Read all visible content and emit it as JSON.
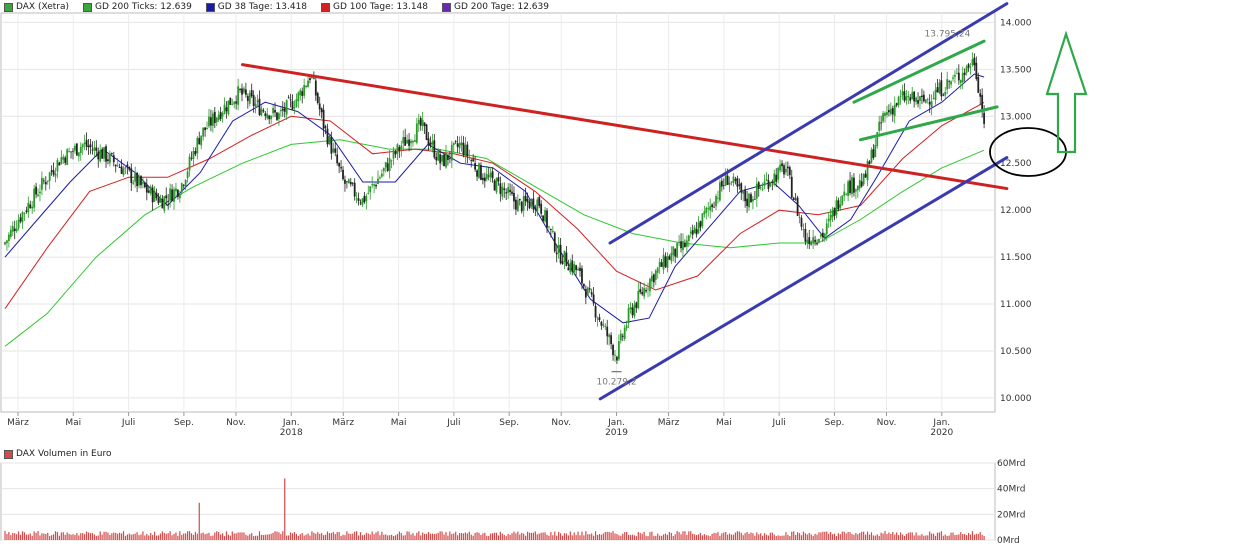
{
  "legend": [
    {
      "label": "DAX (Xetra)",
      "color": "#3ea43e"
    },
    {
      "label": "GD 200 Ticks: 12.639",
      "color": "#3ea43e"
    },
    {
      "label": "GD 38 Tage: 13.418",
      "color": "#1a1aa8"
    },
    {
      "label": "GD 100 Tage: 13.148",
      "color": "#d42020"
    },
    {
      "label": "GD 200 Tage: 12.639",
      "color": "#6a2ab0"
    }
  ],
  "volume_title": "DAX Volumen in Euro",
  "volume_color": "#d44a4a",
  "annotations": {
    "high": "13.795,24",
    "low": "10.279,2"
  },
  "chart_data": [
    {
      "type": "line",
      "series_label": "DAX (Xetra)",
      "y_ticks": [
        "14.000",
        "13.500",
        "13.000",
        "12.500",
        "12.000",
        "11.500",
        "11.000",
        "10.500",
        "10.000"
      ],
      "y_tick_values": [
        14000,
        13500,
        13000,
        12500,
        12000,
        11500,
        11000,
        10500,
        10000
      ],
      "ylim": [
        9850,
        14100
      ],
      "x_ticks": [
        {
          "label": "März",
          "sub": ""
        },
        {
          "label": "Mai",
          "sub": ""
        },
        {
          "label": "Juli",
          "sub": ""
        },
        {
          "label": "Sep.",
          "sub": ""
        },
        {
          "label": "Nov.",
          "sub": ""
        },
        {
          "label": "Jan.",
          "sub": "2018"
        },
        {
          "label": "März",
          "sub": ""
        },
        {
          "label": "Mai",
          "sub": ""
        },
        {
          "label": "Juli",
          "sub": ""
        },
        {
          "label": "Sep.",
          "sub": ""
        },
        {
          "label": "Nov.",
          "sub": ""
        },
        {
          "label": "Jan.",
          "sub": "2019"
        },
        {
          "label": "März",
          "sub": ""
        },
        {
          "label": "Mai",
          "sub": ""
        },
        {
          "label": "Juli",
          "sub": ""
        },
        {
          "label": "Sep.",
          "sub": ""
        },
        {
          "label": "Nov.",
          "sub": ""
        },
        {
          "label": "Jan.",
          "sub": "2020"
        }
      ],
      "price": [
        [
          2017.12,
          11650
        ],
        [
          2017.16,
          11900
        ],
        [
          2017.22,
          12200
        ],
        [
          2017.29,
          12550
        ],
        [
          2017.36,
          12700
        ],
        [
          2017.42,
          12600
        ],
        [
          2017.48,
          12450
        ],
        [
          2017.54,
          12250
        ],
        [
          2017.6,
          12100
        ],
        [
          2017.66,
          12250
        ],
        [
          2017.72,
          12800
        ],
        [
          2017.78,
          13050
        ],
        [
          2017.84,
          13250
        ],
        [
          2017.9,
          13100
        ],
        [
          2017.96,
          13000
        ],
        [
          2018.02,
          13200
        ],
        [
          2018.06,
          13450
        ],
        [
          2018.1,
          12900
        ],
        [
          2018.16,
          12300
        ],
        [
          2018.22,
          12100
        ],
        [
          2018.28,
          12400
        ],
        [
          2018.34,
          12700
        ],
        [
          2018.4,
          12900
        ],
        [
          2018.46,
          12500
        ],
        [
          2018.52,
          12700
        ],
        [
          2018.58,
          12400
        ],
        [
          2018.64,
          12250
        ],
        [
          2018.7,
          12050
        ],
        [
          2018.76,
          12100
        ],
        [
          2018.82,
          11550
        ],
        [
          2018.88,
          11350
        ],
        [
          2018.94,
          10900
        ],
        [
          2019.0,
          10450
        ],
        [
          2019.04,
          10900
        ],
        [
          2019.1,
          11250
        ],
        [
          2019.16,
          11500
        ],
        [
          2019.22,
          11650
        ],
        [
          2019.28,
          12000
        ],
        [
          2019.34,
          12350
        ],
        [
          2019.4,
          12100
        ],
        [
          2019.46,
          12300
        ],
        [
          2019.52,
          12450
        ],
        [
          2019.58,
          11700
        ],
        [
          2019.64,
          11750
        ],
        [
          2019.7,
          12250
        ],
        [
          2019.76,
          12300
        ],
        [
          2019.82,
          13000
        ],
        [
          2019.88,
          13200
        ],
        [
          2019.94,
          13150
        ],
        [
          2020.0,
          13300
        ],
        [
          2020.06,
          13450
        ],
        [
          2020.1,
          13600
        ],
        [
          2020.13,
          12950
        ]
      ],
      "gd38": [
        [
          2017.12,
          11500
        ],
        [
          2017.22,
          11900
        ],
        [
          2017.32,
          12300
        ],
        [
          2017.42,
          12650
        ],
        [
          2017.52,
          12400
        ],
        [
          2017.62,
          12050
        ],
        [
          2017.72,
          12400
        ],
        [
          2017.82,
          12950
        ],
        [
          2017.92,
          13150
        ],
        [
          2018.02,
          13050
        ],
        [
          2018.12,
          12800
        ],
        [
          2018.22,
          12300
        ],
        [
          2018.32,
          12300
        ],
        [
          2018.42,
          12700
        ],
        [
          2018.52,
          12500
        ],
        [
          2018.62,
          12450
        ],
        [
          2018.72,
          12200
        ],
        [
          2018.82,
          11600
        ],
        [
          2018.92,
          11050
        ],
        [
          2019.02,
          10800
        ],
        [
          2019.1,
          10850
        ],
        [
          2019.18,
          11400
        ],
        [
          2019.28,
          11800
        ],
        [
          2019.38,
          12200
        ],
        [
          2019.48,
          12300
        ],
        [
          2019.56,
          12050
        ],
        [
          2019.64,
          11700
        ],
        [
          2019.72,
          11900
        ],
        [
          2019.8,
          12350
        ],
        [
          2019.9,
          12950
        ],
        [
          2020.0,
          13150
        ],
        [
          2020.1,
          13450
        ],
        [
          2020.13,
          13418
        ]
      ],
      "gd100": [
        [
          2017.12,
          10950
        ],
        [
          2017.25,
          11600
        ],
        [
          2017.38,
          12200
        ],
        [
          2017.5,
          12350
        ],
        [
          2017.62,
          12350
        ],
        [
          2017.75,
          12550
        ],
        [
          2017.88,
          12800
        ],
        [
          2018.0,
          13000
        ],
        [
          2018.12,
          12950
        ],
        [
          2018.25,
          12600
        ],
        [
          2018.38,
          12650
        ],
        [
          2018.5,
          12600
        ],
        [
          2018.62,
          12500
        ],
        [
          2018.75,
          12200
        ],
        [
          2018.88,
          11800
        ],
        [
          2019.0,
          11350
        ],
        [
          2019.12,
          11150
        ],
        [
          2019.25,
          11300
        ],
        [
          2019.38,
          11750
        ],
        [
          2019.5,
          12000
        ],
        [
          2019.62,
          11950
        ],
        [
          2019.75,
          12050
        ],
        [
          2019.88,
          12550
        ],
        [
          2020.0,
          12900
        ],
        [
          2020.13,
          13148
        ]
      ],
      "gd200": [
        [
          2017.12,
          10550
        ],
        [
          2017.25,
          10900
        ],
        [
          2017.4,
          11500
        ],
        [
          2017.55,
          11950
        ],
        [
          2017.7,
          12250
        ],
        [
          2017.85,
          12500
        ],
        [
          2018.0,
          12700
        ],
        [
          2018.15,
          12750
        ],
        [
          2018.3,
          12650
        ],
        [
          2018.45,
          12650
        ],
        [
          2018.6,
          12550
        ],
        [
          2018.75,
          12250
        ],
        [
          2018.9,
          11950
        ],
        [
          2019.05,
          11750
        ],
        [
          2019.2,
          11650
        ],
        [
          2019.35,
          11600
        ],
        [
          2019.5,
          11650
        ],
        [
          2019.62,
          11650
        ],
        [
          2019.75,
          11900
        ],
        [
          2019.88,
          12200
        ],
        [
          2020.0,
          12450
        ],
        [
          2020.13,
          12639
        ]
      ],
      "trendlines": [
        {
          "color": "#cc2222",
          "from": [
            2017.85,
            13550
          ],
          "to": [
            2020.2,
            12230
          ]
        },
        {
          "color": "#3a3ab0",
          "from": [
            2018.95,
            9990
          ],
          "to": [
            2020.2,
            12560
          ]
        },
        {
          "color": "#3a3ab0",
          "from": [
            2018.98,
            11650
          ],
          "to": [
            2020.2,
            14200
          ]
        },
        {
          "color": "#2fa84a",
          "from": [
            2019.75,
            12750
          ],
          "to": [
            2020.17,
            13100
          ]
        },
        {
          "color": "#2fa84a",
          "from": [
            2019.73,
            13150
          ],
          "to": [
            2020.13,
            13800
          ]
        }
      ],
      "markers": {
        "high": [
          2020.1,
          13795
        ],
        "low": [
          2019.0,
          10279
        ]
      }
    },
    {
      "type": "bar",
      "series_label": "DAX Volumen in Euro",
      "y_ticks": [
        "60Mrd",
        "40Mrd",
        "20Mrd",
        "0Mrd"
      ],
      "y_tick_values": [
        60,
        40,
        20,
        0
      ],
      "ylim": [
        0,
        60
      ],
      "spikes": [
        [
          2017.72,
          29
        ],
        [
          2017.98,
          48
        ]
      ],
      "typical_range": [
        3,
        7
      ]
    }
  ]
}
